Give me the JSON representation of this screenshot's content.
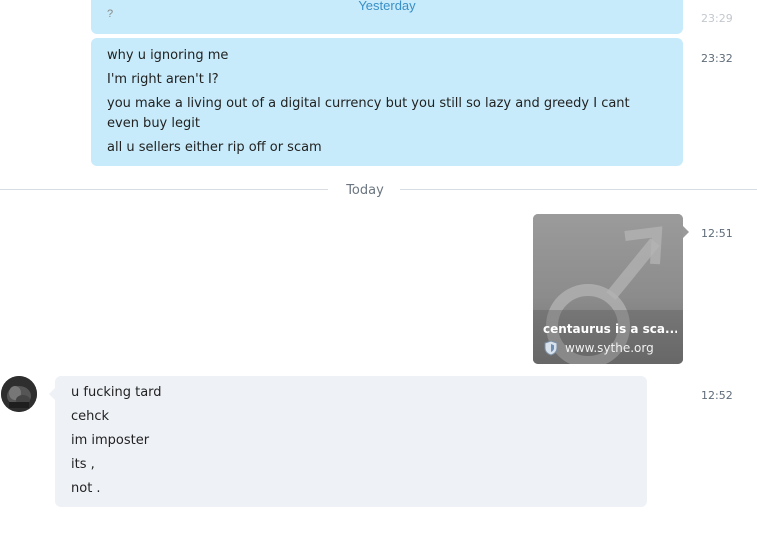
{
  "messages": {
    "top_fragment": {
      "date_label": "Yesterday",
      "partial_text": "?",
      "timestamp": "23:29"
    },
    "outgoing_1": {
      "timestamp": "23:32",
      "lines": [
        "why u ignoring me",
        "I'm right aren't I?",
        "you make a living out of a digital currency but you still so lazy and greedy I cant even buy legit",
        "all u sellers either rip off or scam"
      ]
    },
    "divider": {
      "label": "Today"
    },
    "link_card": {
      "timestamp": "12:51",
      "title": "centaurus is a sca...",
      "site": "www.sythe.org",
      "icon": "shield-icon"
    },
    "incoming_1": {
      "timestamp": "12:52",
      "avatar_icon": "avatar",
      "lines": [
        "u fucking tard",
        "cehck",
        "im imposter",
        "its ,",
        "not ."
      ]
    }
  },
  "colors": {
    "outgoing_bubble": "#c7ebfa",
    "incoming_bubble": "#eef1f6",
    "card_bg": "#8a8a8a",
    "link_blue": "#3a8fc7"
  }
}
